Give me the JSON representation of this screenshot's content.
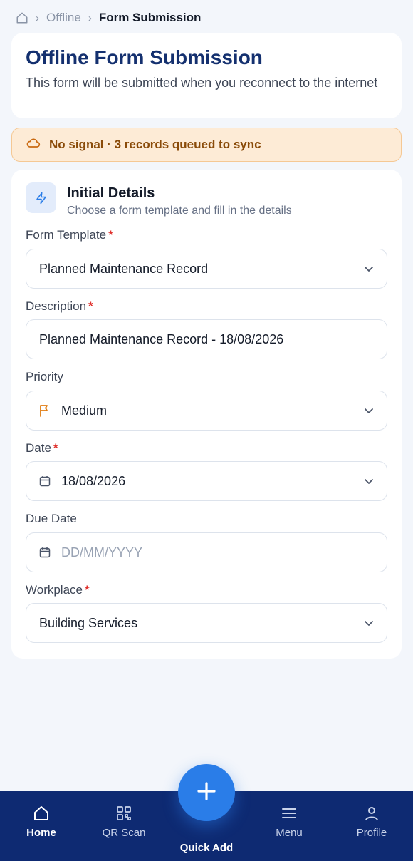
{
  "breadcrumb": {
    "parent": "Offline",
    "current": "Form Submission"
  },
  "header": {
    "title": "Offline Form Submission",
    "subtitle": "This form will be submitted when you reconnect to the internet"
  },
  "banner": {
    "text": "No signal · 3 records queued to sync",
    "icon": "cloud-off-icon"
  },
  "section": {
    "title": "Initial Details",
    "subtitle": "Choose a form template and fill in the details",
    "icon": "lightning-icon"
  },
  "fields": {
    "template": {
      "label": "Form Template",
      "required": "*",
      "value": "Planned Maintenance Record"
    },
    "description": {
      "label": "Description",
      "required": "*",
      "value": "Planned Maintenance Record - 18/08/2026"
    },
    "priority": {
      "label": "Priority",
      "value": "Medium"
    },
    "date": {
      "label": "Date",
      "required": "*",
      "value": "18/08/2026"
    },
    "due_date": {
      "label": "Due Date",
      "placeholder": "DD/MM/YYYY"
    },
    "workplace": {
      "label": "Workplace",
      "required": "*",
      "value": "Building Services"
    }
  },
  "nav": {
    "home": "Home",
    "qr": "QR Scan",
    "quick_add": "Quick Add",
    "menu": "Menu",
    "profile": "Profile"
  },
  "colors": {
    "primary": "#14306f",
    "accent": "#2a7de8",
    "nav_bg": "#0e2a72",
    "warning_bg": "#fdebd6",
    "warning_text": "#8a4b09",
    "required": "#e0322e"
  }
}
